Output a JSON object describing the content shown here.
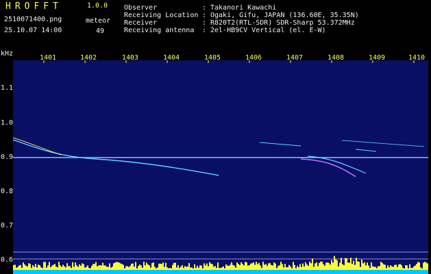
{
  "header": {
    "app_title": "HROFFT",
    "version": "1.0.0",
    "filename": "2510071400.png",
    "datetime": "25.10.07 14:00",
    "meteor_label": "meteor",
    "meteor_count": "49"
  },
  "info": [
    {
      "label": "Observer",
      "value": "Takanori Kawachi"
    },
    {
      "label": "Receiving Location",
      "value": "Ogaki, Gifu, JAPAN (136.60E, 35.35N)"
    },
    {
      "label": "Receiver",
      "value": "R820T2(RTL-SDR) SDR-Sharp 53.372MHz"
    },
    {
      "label": "Receiving antenna",
      "value": "2el-HB9CV Vertical (el. E-W)"
    }
  ],
  "axis": {
    "y_unit": "kHz",
    "time_ticks": [
      "1401",
      "1402",
      "1403",
      "1404",
      "1405",
      "1406",
      "1407",
      "1408",
      "1409",
      "1410"
    ],
    "freq_ticks": [
      "1.1",
      "1.0",
      "0.9",
      "0.8",
      "0.7",
      "0.6"
    ]
  },
  "colors": {
    "label_yellow": "#ffff55",
    "background": "#000000",
    "spectrogram_noise": "#0a1270",
    "trace": "#60d8ff",
    "carrier": "#9fd0ff",
    "activity": "#ffff33",
    "activity_base": "#00c8ff"
  }
}
